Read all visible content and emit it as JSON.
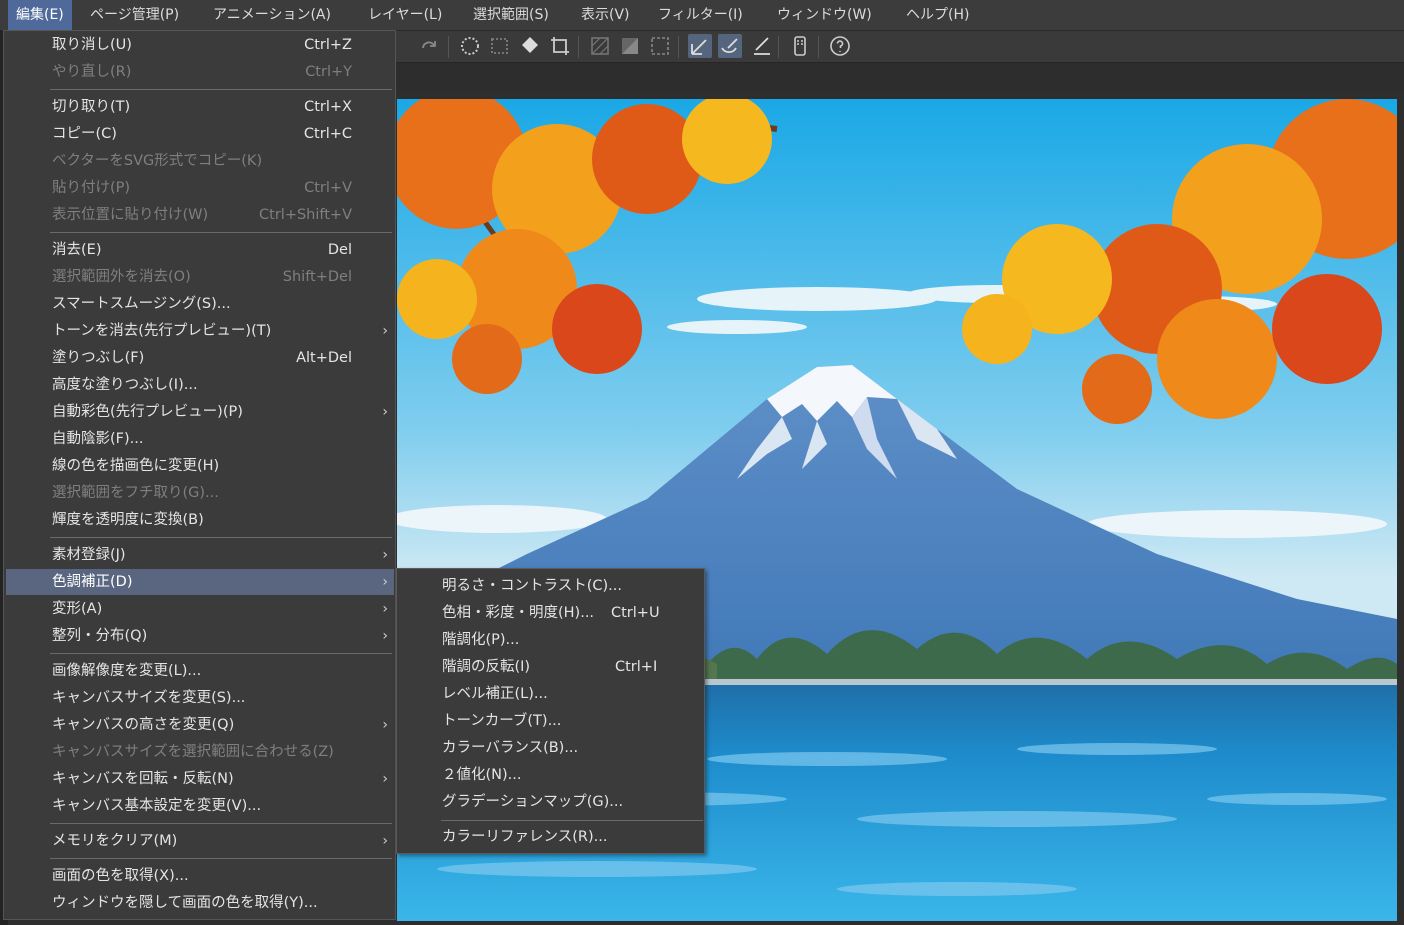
{
  "menubar": [
    {
      "id": "edit",
      "label": "編集(E)",
      "active": true
    },
    {
      "id": "page",
      "label": "ページ管理(P)"
    },
    {
      "id": "animation",
      "label": "アニメーション(A)"
    },
    {
      "id": "layer",
      "label": "レイヤー(L)"
    },
    {
      "id": "selection",
      "label": "選択範囲(S)"
    },
    {
      "id": "view",
      "label": "表示(V)"
    },
    {
      "id": "filter",
      "label": "フィルター(I)"
    },
    {
      "id": "window",
      "label": "ウィンドウ(W)"
    },
    {
      "id": "help",
      "label": "ヘルプ(H)"
    }
  ],
  "toolbar_icons": [
    "redo-icon",
    "transform-select-icon",
    "select-marquee-icon",
    "fill-icon",
    "crop-icon",
    "hatch-icon",
    "gradient-icon",
    "frame-icon",
    "pen-stabilize-icon",
    "pen-vector-icon",
    "pen-option-icon",
    "device-icon",
    "help-icon"
  ],
  "edit_menu": [
    {
      "label": "取り消し(U)",
      "shortcut": "Ctrl+Z",
      "enabled": true
    },
    {
      "label": "やり直し(R)",
      "shortcut": "Ctrl+Y",
      "enabled": false
    },
    {
      "sep": true
    },
    {
      "label": "切り取り(T)",
      "shortcut": "Ctrl+X",
      "enabled": true
    },
    {
      "label": "コピー(C)",
      "shortcut": "Ctrl+C",
      "enabled": true
    },
    {
      "label": "ベクターをSVG形式でコピー(K)",
      "enabled": false
    },
    {
      "label": "貼り付け(P)",
      "shortcut": "Ctrl+V",
      "enabled": false
    },
    {
      "label": "表示位置に貼り付け(W)",
      "shortcut": "Ctrl+Shift+V",
      "enabled": false
    },
    {
      "sep": true
    },
    {
      "label": "消去(E)",
      "shortcut": "Del",
      "enabled": true
    },
    {
      "label": "選択範囲外を消去(O)",
      "shortcut": "Shift+Del",
      "enabled": false
    },
    {
      "label": "スマートスムージング(S)...",
      "enabled": true
    },
    {
      "label": "トーンを消去(先行プレビュー)(T)",
      "enabled": true,
      "submenu": true
    },
    {
      "label": "塗りつぶし(F)",
      "shortcut": "Alt+Del",
      "enabled": true
    },
    {
      "label": "高度な塗りつぶし(I)...",
      "enabled": true
    },
    {
      "label": "自動彩色(先行プレビュー)(P)",
      "enabled": true,
      "submenu": true
    },
    {
      "label": "自動陰影(F)...",
      "enabled": true
    },
    {
      "label": "線の色を描画色に変更(H)",
      "enabled": true
    },
    {
      "label": "選択範囲をフチ取り(G)...",
      "enabled": false
    },
    {
      "label": "輝度を透明度に変換(B)",
      "enabled": true
    },
    {
      "sep": true
    },
    {
      "label": "素材登録(J)",
      "enabled": true,
      "submenu": true
    },
    {
      "label": "色調補正(D)",
      "enabled": true,
      "submenu": true,
      "highlighted": true
    },
    {
      "label": "変形(A)",
      "enabled": true,
      "submenu": true
    },
    {
      "label": "整列・分布(Q)",
      "enabled": true,
      "submenu": true
    },
    {
      "sep": true
    },
    {
      "label": "画像解像度を変更(L)...",
      "enabled": true
    },
    {
      "label": "キャンバスサイズを変更(S)...",
      "enabled": true
    },
    {
      "label": "キャンバスの高さを変更(Q)",
      "enabled": true,
      "submenu": true
    },
    {
      "label": "キャンバスサイズを選択範囲に合わせる(Z)",
      "enabled": false
    },
    {
      "label": "キャンバスを回転・反転(N)",
      "enabled": true,
      "submenu": true
    },
    {
      "label": "キャンバス基本設定を変更(V)...",
      "enabled": true
    },
    {
      "sep": true
    },
    {
      "label": "メモリをクリア(M)",
      "enabled": true,
      "submenu": true
    },
    {
      "sep": true
    },
    {
      "label": "画面の色を取得(X)...",
      "enabled": true
    },
    {
      "label": "ウィンドウを隠して画面の色を取得(Y)...",
      "enabled": true
    }
  ],
  "color_submenu": [
    {
      "label": "明るさ・コントラスト(C)..."
    },
    {
      "label": "色相・彩度・明度(H)...",
      "shortcut": "Ctrl+U"
    },
    {
      "label": "階調化(P)..."
    },
    {
      "label": "階調の反転(I)",
      "shortcut": "Ctrl+I"
    },
    {
      "label": "レベル補正(L)..."
    },
    {
      "label": "トーンカーブ(T)..."
    },
    {
      "label": "カラーバランス(B)..."
    },
    {
      "label": "２値化(N)..."
    },
    {
      "label": "グラデーションマップ(G)..."
    },
    {
      "sep": true
    },
    {
      "label": "カラーリファレンス(R)..."
    }
  ],
  "canvas_image": "mount-fuji-autumn-maple-lake-illustration",
  "colors": {
    "menu_bg": "#3b3b3b",
    "highlight": "#5a6680",
    "menubar_active": "#4f6a9a",
    "disabled_text": "#7f7f7f"
  }
}
